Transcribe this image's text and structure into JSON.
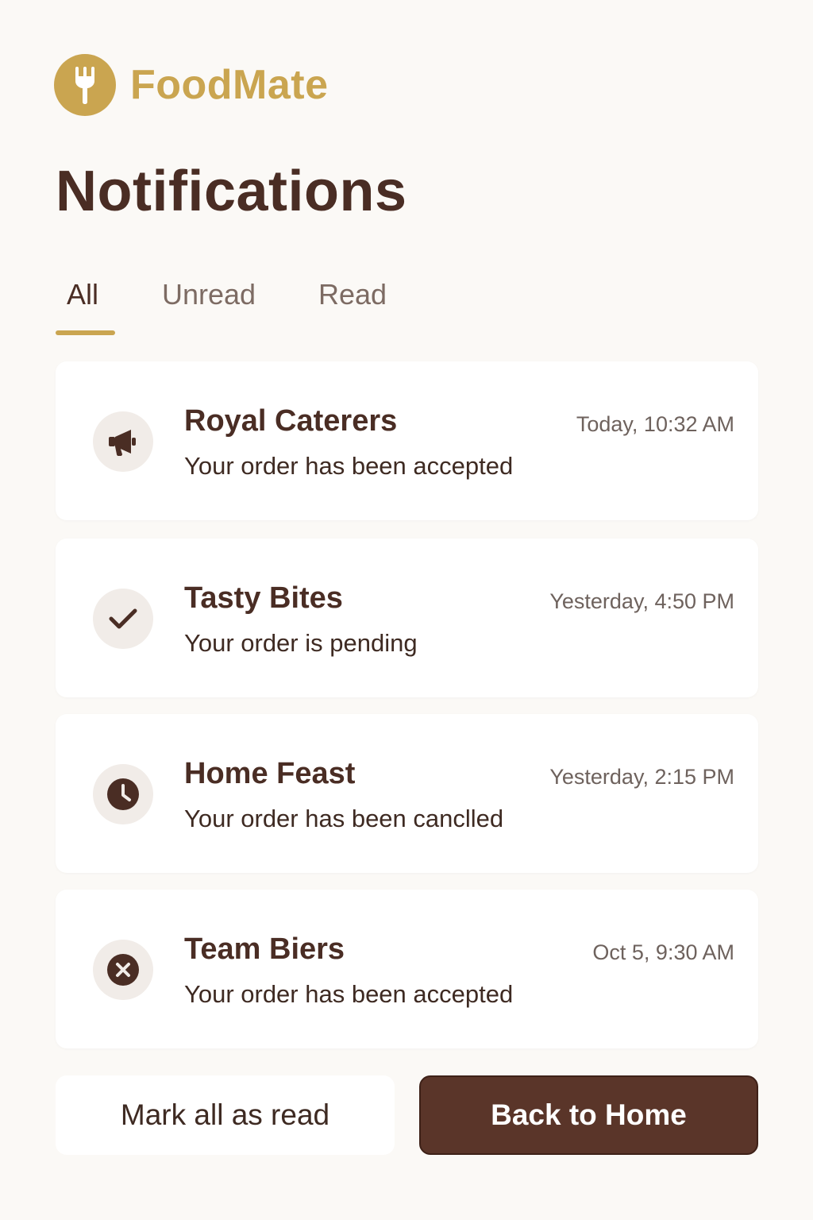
{
  "brand": {
    "name": "FoodMate",
    "logo_icon": "fork-icon",
    "color": "#caa550"
  },
  "page": {
    "title": "Notifications"
  },
  "tabs": [
    {
      "label": "All",
      "active": true
    },
    {
      "label": "Unread",
      "active": false
    },
    {
      "label": "Read",
      "active": false
    }
  ],
  "notifications": [
    {
      "title": "Royal Caterers",
      "message": "Your order has been accepted",
      "time": "Today, 10:32 AM",
      "icon": "megaphone-icon"
    },
    {
      "title": "Tasty Bites",
      "message": "Your order is pending",
      "time": "Yesterday, 4:50 PM",
      "icon": "check-icon"
    },
    {
      "title": "Home Feast",
      "message": "Your order has been canclled",
      "time": "Yesterday, 2:15 PM",
      "icon": "clock-icon"
    },
    {
      "title": "Team Biers",
      "message": "Your order has been accepted",
      "time": "Oct 5, 9:30 AM",
      "icon": "x-circle-icon"
    }
  ],
  "actions": {
    "mark_all_label": "Mark all as read",
    "back_home_label": "Back to Home"
  },
  "colors": {
    "accent": "#caa550",
    "primary_brown": "#5a3529",
    "text_dark": "#4a2d24",
    "background": "#fbf9f6"
  }
}
